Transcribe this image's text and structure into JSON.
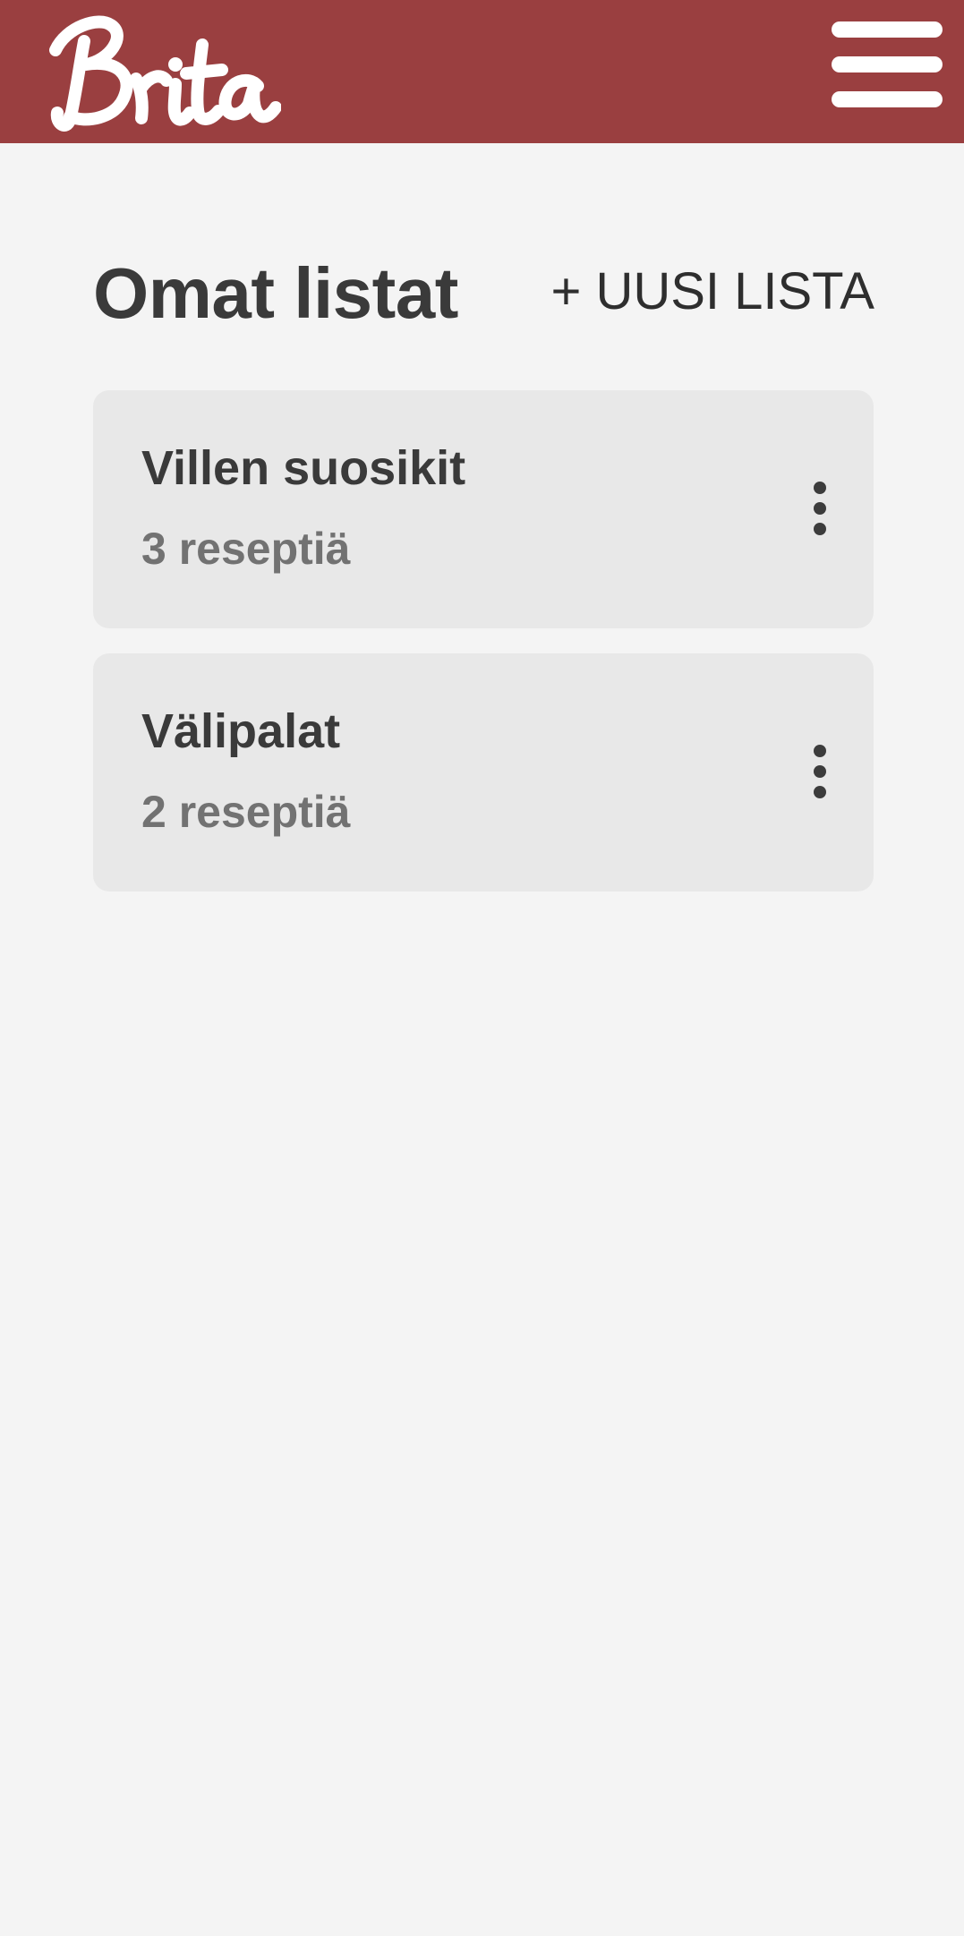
{
  "header": {
    "logo_text": "Brita",
    "menu_icon": "hamburger-menu-icon",
    "background_color": "#9a3f40"
  },
  "main": {
    "title": "Omat listat",
    "new_list_label": "+ UUSI LISTA",
    "lists": [
      {
        "name": "Villen suosikit",
        "count": "3 reseptiä"
      },
      {
        "name": "Välipalat",
        "count": "2 reseptiä"
      }
    ]
  }
}
